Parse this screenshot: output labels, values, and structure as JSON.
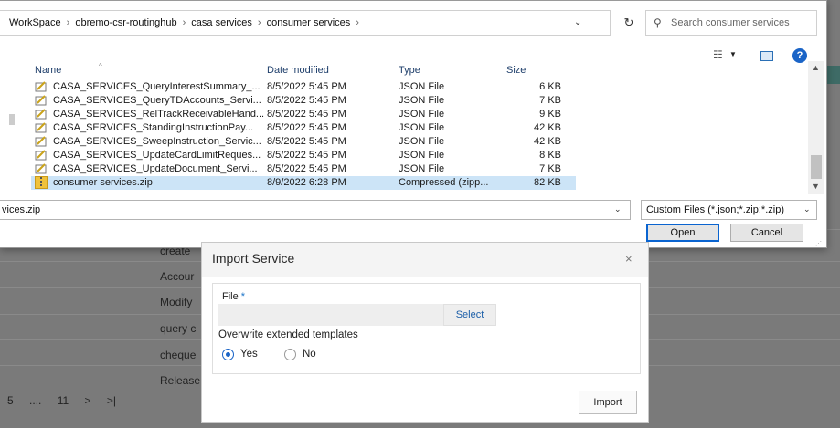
{
  "background": {
    "rows": [
      "create",
      "Accour",
      "Modify",
      "query c",
      "cheque",
      "Release"
    ],
    "pager": [
      "5",
      "....",
      "11",
      ">",
      ">|"
    ]
  },
  "file_dialog": {
    "breadcrumb": [
      "WorkSpace",
      "obremo-csr-routinghub",
      "casa services",
      "consumer services"
    ],
    "search_placeholder": "Search consumer services",
    "columns": {
      "name": "Name",
      "date": "Date modified",
      "type": "Type",
      "size": "Size"
    },
    "files": [
      {
        "name": "CASA_SERVICES_QueryInterestSummary_...",
        "date": "8/5/2022 5:45 PM",
        "type": "JSON File",
        "size": "6 KB",
        "icon": "json-file-icon"
      },
      {
        "name": "CASA_SERVICES_QueryTDAccounts_Servi...",
        "date": "8/5/2022 5:45 PM",
        "type": "JSON File",
        "size": "7 KB",
        "icon": "json-file-icon"
      },
      {
        "name": "CASA_SERVICES_RelTrackReceivableHand...",
        "date": "8/5/2022 5:45 PM",
        "type": "JSON File",
        "size": "9 KB",
        "icon": "json-file-icon"
      },
      {
        "name": "CASA_SERVICES_StandingInstructionPay...",
        "date": "8/5/2022 5:45 PM",
        "type": "JSON File",
        "size": "42 KB",
        "icon": "json-file-icon"
      },
      {
        "name": "CASA_SERVICES_SweepInstruction_Servic...",
        "date": "8/5/2022 5:45 PM",
        "type": "JSON File",
        "size": "42 KB",
        "icon": "json-file-icon"
      },
      {
        "name": "CASA_SERVICES_UpdateCardLimitReques...",
        "date": "8/5/2022 5:45 PM",
        "type": "JSON File",
        "size": "8 KB",
        "icon": "json-file-icon"
      },
      {
        "name": "CASA_SERVICES_UpdateDocument_Servi...",
        "date": "8/5/2022 5:45 PM",
        "type": "JSON File",
        "size": "7 KB",
        "icon": "json-file-icon"
      },
      {
        "name": "consumer services.zip",
        "date": "8/9/2022 6:28 PM",
        "type": "Compressed (zipp...",
        "size": "82 KB",
        "icon": "zip-file-icon",
        "selected": true
      }
    ],
    "filename_value": "vices.zip",
    "filter_value": "Custom Files (*.json;*.zip;*.zip)",
    "open_label": "Open",
    "cancel_label": "Cancel",
    "colors": {
      "selected_row": "#cce4f7",
      "focus_blue": "#0a64d0"
    }
  },
  "import_dialog": {
    "title": "Import Service",
    "close_glyph": "×",
    "file_label": "File",
    "required_mark": "*",
    "select_label": "Select",
    "overwrite_label": "Overwrite extended templates",
    "options": [
      {
        "label": "Yes",
        "checked": true
      },
      {
        "label": "No",
        "checked": false
      }
    ],
    "import_label": "Import"
  }
}
